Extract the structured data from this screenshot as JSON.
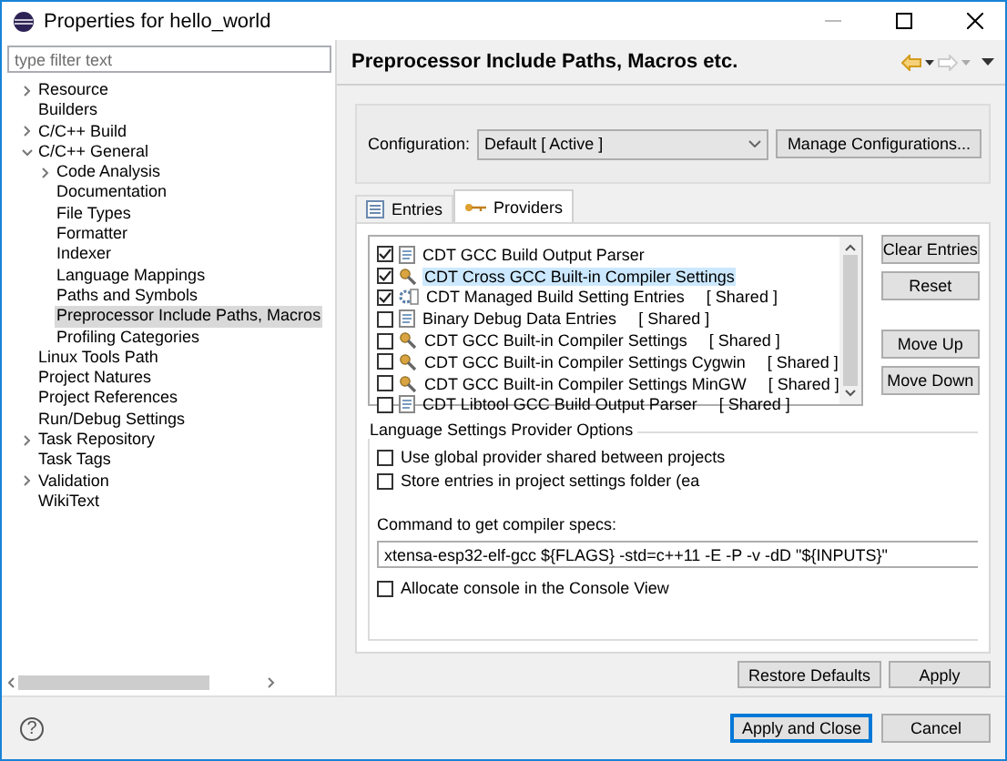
{
  "window": {
    "title": "Properties for hello_world"
  },
  "sidebar": {
    "filter": {
      "placeholder": "type filter text"
    },
    "items": [
      {
        "label": "Resource",
        "expanded": false,
        "selected": false
      },
      {
        "label": "Builders",
        "selected": false
      },
      {
        "label": "C/C++ Build",
        "expanded": false,
        "selected": false
      },
      {
        "label": "C/C++ General",
        "expanded": true,
        "selected": false,
        "children": [
          {
            "label": "Code Analysis",
            "expanded": false,
            "selected": false
          },
          {
            "label": "Documentation",
            "selected": false
          },
          {
            "label": "File Types",
            "selected": false
          },
          {
            "label": "Formatter",
            "selected": false
          },
          {
            "label": "Indexer",
            "selected": false
          },
          {
            "label": "Language Mappings",
            "selected": false
          },
          {
            "label": "Paths and Symbols",
            "selected": false
          },
          {
            "label": "Preprocessor Include Paths, Macros",
            "selected": true
          },
          {
            "label": "Profiling Categories",
            "selected": false
          }
        ]
      },
      {
        "label": "Linux Tools Path",
        "selected": false
      },
      {
        "label": "Project Natures",
        "selected": false
      },
      {
        "label": "Project References",
        "selected": false
      },
      {
        "label": "Run/Debug Settings",
        "selected": false
      },
      {
        "label": "Task Repository",
        "expanded": false,
        "selected": false
      },
      {
        "label": "Task Tags",
        "selected": false
      },
      {
        "label": "Validation",
        "expanded": false,
        "selected": false
      },
      {
        "label": "WikiText",
        "selected": false
      }
    ]
  },
  "page": {
    "title": "Preprocessor Include Paths, Macros etc.",
    "configuration": {
      "label": "Configuration:",
      "value": "Default  [ Active ]",
      "button": "Manage Configurations..."
    },
    "tabs": [
      {
        "label": "Entries",
        "kind": "entries",
        "selected": false
      },
      {
        "label": "Providers",
        "kind": "providers",
        "selected": true
      }
    ],
    "providers": [
      {
        "label": "CDT GCC Build Output Parser",
        "kind": "parser",
        "checked": true,
        "selected": false
      },
      {
        "label": "CDT Cross GCC Built-in Compiler Settings",
        "kind": "builtin",
        "checked": true,
        "selected": true
      },
      {
        "label": "CDT Managed Build Setting Entries",
        "tag": "[ Shared ]",
        "kind": "managed",
        "checked": true,
        "selected": false
      },
      {
        "label": "Binary Debug Data Entries",
        "tag": "[ Shared ]",
        "kind": "parser",
        "checked": false,
        "selected": false
      },
      {
        "label": "CDT GCC Built-in Compiler Settings",
        "tag": "[ Shared ]",
        "kind": "builtin",
        "checked": false,
        "selected": false
      },
      {
        "label": "CDT GCC Built-in Compiler Settings Cygwin",
        "tag": "[ Shared ]",
        "kind": "builtin",
        "checked": false,
        "selected": false
      },
      {
        "label": "CDT GCC Built-in Compiler Settings MinGW",
        "tag": "[ Shared ]",
        "kind": "builtin",
        "checked": false,
        "selected": false
      },
      {
        "label": "CDT Libtool GCC Build Output Parser",
        "tag": "[ Shared ]",
        "kind": "parser",
        "checked": false,
        "selected": false
      }
    ],
    "side_buttons": [
      "Clear Entries",
      "Reset",
      "Move Up",
      "Move Down"
    ],
    "options": {
      "legend": "Language Settings Provider Options",
      "global": {
        "label": "Use global provider shared between projects",
        "checked": false
      },
      "store": {
        "label": "Store entries in project settings folder (ea",
        "checked": false
      },
      "command_label": "Command to get compiler specs:",
      "command": "xtensa-esp32-elf-gcc ${FLAGS} -std=c++11 -E -P -v -dD \"${INPUTS}\"",
      "console": {
        "label": "Allocate console in the Console View",
        "checked": false
      }
    },
    "buttons": [
      "Restore Defaults",
      "Apply"
    ]
  },
  "footer": {
    "help": "?",
    "buttons": [
      {
        "label": "Apply and Close",
        "default": true
      },
      {
        "label": "Cancel",
        "default": false
      }
    ]
  }
}
